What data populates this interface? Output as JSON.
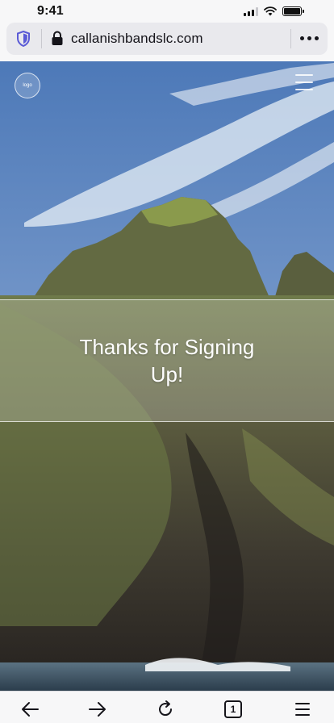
{
  "status_bar": {
    "time": "9:41",
    "icons": [
      "cellular-signal-icon",
      "wifi-icon",
      "battery-icon"
    ]
  },
  "browser": {
    "url": "callanishbandslc.com",
    "icons": [
      "tracking-shield-icon",
      "lock-icon",
      "more-options-icon"
    ],
    "accent_color": "#5b5bd6"
  },
  "site": {
    "logo_text": "logo",
    "thanks_message": "Thanks for Signing Up!"
  },
  "bottom_toolbar": {
    "tab_count": "1",
    "icons": [
      "back-arrow-icon",
      "forward-arrow-icon",
      "reload-icon",
      "tabs-icon",
      "menu-icon"
    ]
  }
}
